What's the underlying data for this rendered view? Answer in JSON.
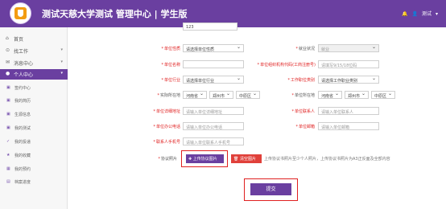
{
  "header": {
    "title": "测试天慈大学测试  管理中心  |  学生版",
    "bell_icon": "bell-icon",
    "user_icon": "user-icon",
    "user_name": "测试",
    "caret": "▾"
  },
  "sidebar": {
    "items": [
      {
        "icon": "home-icon",
        "glyph": "⌂",
        "label": "首页"
      },
      {
        "icon": "search-icon",
        "glyph": "⊙",
        "label": "找工作",
        "arrow": "▾"
      },
      {
        "icon": "message-icon",
        "glyph": "✉",
        "label": "消息中心",
        "arrow": "▾"
      },
      {
        "icon": "user-icon",
        "glyph": "●",
        "label": "个人中心",
        "arrow": "▾"
      }
    ],
    "sub_items": [
      {
        "label": "签约中心"
      },
      {
        "label": "我的简历"
      },
      {
        "label": "生源信息"
      },
      {
        "label": "我的测试"
      },
      {
        "label": "我的投递"
      },
      {
        "label": "我的收藏"
      },
      {
        "label": "我的预约"
      },
      {
        "label": "档案进度"
      }
    ]
  },
  "form": {
    "top_input_value": "123",
    "unit_nature": {
      "label": "单位性质",
      "value": "请选择单位性质"
    },
    "employment_status": {
      "label": "就业状况",
      "value": "就业"
    },
    "unit_name": {
      "label": "单位名称",
      "value": ""
    },
    "org_code": {
      "label": "单位组织机构代码(工商注册号)",
      "value": "请填写9/15/18位码"
    },
    "industry": {
      "label": "单位行业",
      "value": "请选择单位行业"
    },
    "job_category": {
      "label": "工作职位类别",
      "value": "请选择工作职业类别"
    },
    "actual_location": {
      "label": "实际所在地",
      "province": "河南省",
      "city": "郑州市",
      "district": "中原区"
    },
    "unit_location": {
      "label": "单位所在地",
      "province": "河南省",
      "city": "郑州市",
      "district": "中原区"
    },
    "unit_address": {
      "label": "单位详细地址",
      "placeholder": "请输入单位详细地址"
    },
    "contact_person": {
      "label": "单位联系人",
      "placeholder": "请输入单位联系人"
    },
    "office_phone": {
      "label": "单位办公电话",
      "placeholder": "请输入单位办公电话"
    },
    "unit_email": {
      "label": "单位邮箱",
      "placeholder": "请输入单位邮箱"
    },
    "contact_mobile": {
      "label": "联系人手机号",
      "placeholder": "请输入单位联系人手机号"
    },
    "agreement_images": {
      "label": "协议照片",
      "upload_label": "上传协议图片",
      "clear_label": "清空图片",
      "note": "上传协议书照片至少个人照片，上传协议书照片为A3正反面及全部内容"
    },
    "submit_label": "提交"
  },
  "colors": {
    "brand": "#6a3fa0",
    "required": "#e02020",
    "danger": "#e0403a"
  }
}
